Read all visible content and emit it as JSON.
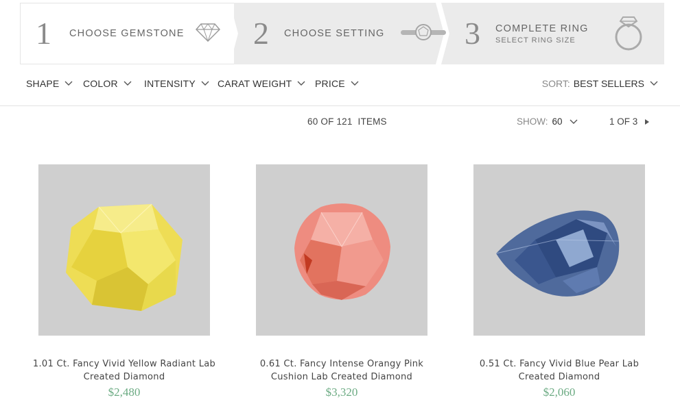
{
  "steps": [
    {
      "number": "1",
      "label": "CHOOSE GEMSTONE",
      "sublabel": "",
      "icon": "diamond-outline-icon"
    },
    {
      "number": "2",
      "label": "CHOOSE SETTING",
      "sublabel": "",
      "icon": "setting-band-icon"
    },
    {
      "number": "3",
      "label": "COMPLETE RING",
      "sublabel": "SELECT RING SIZE",
      "icon": "ring-icon"
    }
  ],
  "filters": [
    {
      "label": "SHAPE"
    },
    {
      "label": "COLOR"
    },
    {
      "label": "INTENSITY"
    },
    {
      "label": "CARAT WEIGHT"
    },
    {
      "label": "PRICE"
    }
  ],
  "sort": {
    "key": "SORT:",
    "value": "BEST SELLERS"
  },
  "results": {
    "count_text": "60 OF 121  ITEMS",
    "show_key": "SHOW:",
    "show_value": "60",
    "page_text": "1 OF 3"
  },
  "products": [
    {
      "title": "1.01 Ct. Fancy Vivid Yellow Radiant Lab Created Diamond",
      "price": "$2,480",
      "stone_color": "#f2e45c",
      "shape": "radiant"
    },
    {
      "title": "0.61 Ct. Fancy Intense Orangy Pink Cushion Lab Created Diamond",
      "price": "$3,320",
      "stone_color": "#ef8f83",
      "shape": "cushion"
    },
    {
      "title": "0.51 Ct. Fancy Vivid Blue Pear Lab Created Diamond",
      "price": "$2,060",
      "stone_color": "#4f6a9c",
      "shape": "pear"
    }
  ],
  "colors": {
    "accent_price": "#6cab83",
    "step_bg": "#ebebeb",
    "image_bg": "#cfcfcf"
  }
}
